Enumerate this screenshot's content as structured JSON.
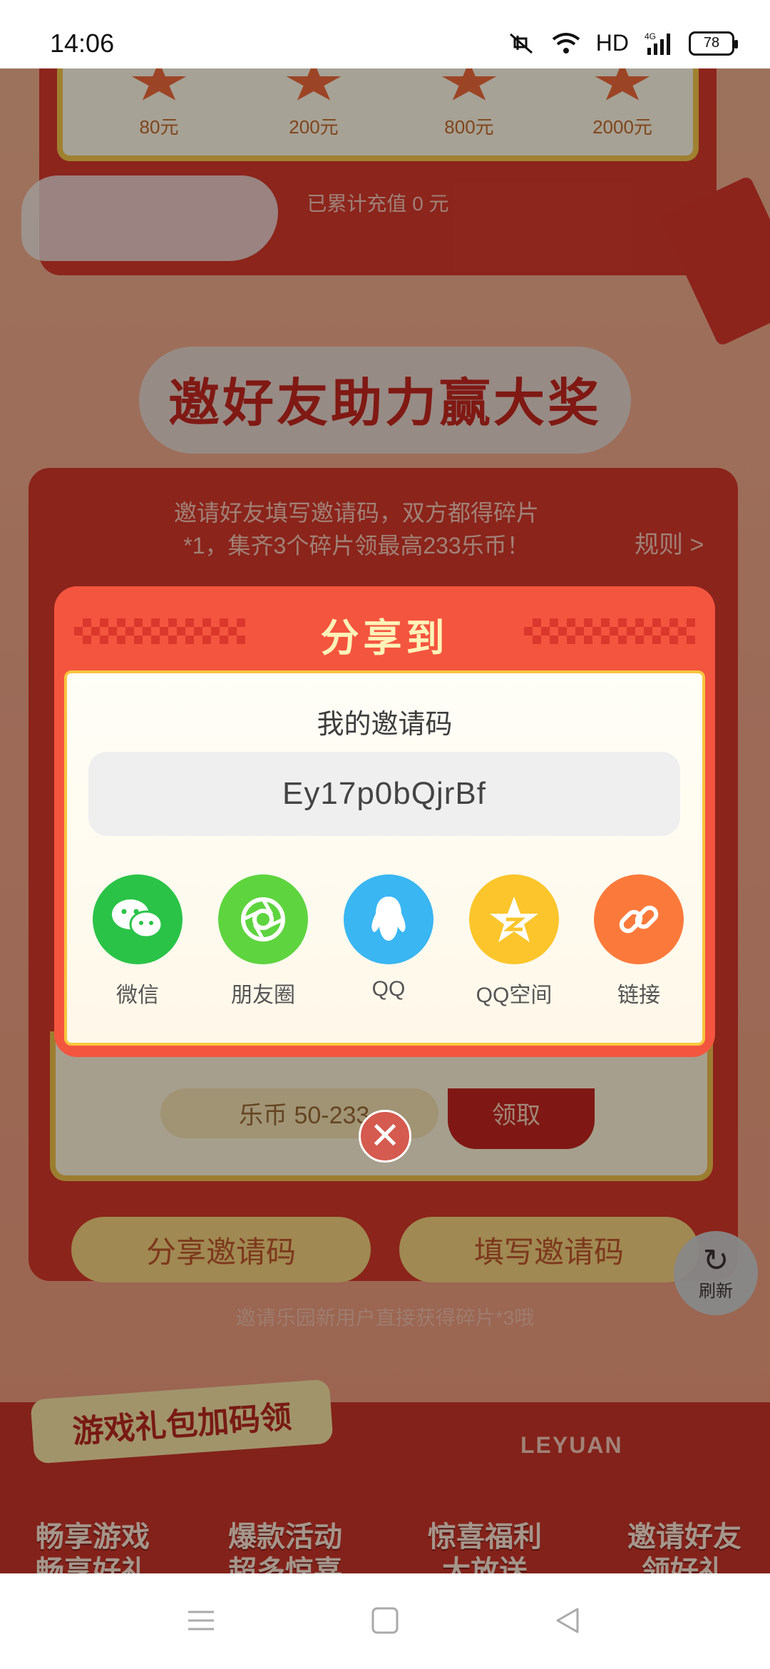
{
  "status_bar": {
    "time": "14:06",
    "network_label": "HD",
    "signal_label": "4G",
    "battery": "78"
  },
  "recharge": {
    "tiers": [
      "80元",
      "200元",
      "800元",
      "2000元"
    ],
    "total_text": "已累计充值 0 元"
  },
  "invite_section": {
    "title": "邀好友助力赢大奖",
    "hint_line1": "邀请好友填写邀请码，双方都得碎片",
    "hint_line2": "*1，集齐3个碎片领最高233乐币！",
    "rules_label": "规则 >",
    "coin_label": "乐币 50-233",
    "claim_label": "领取",
    "share_code_button": "分享邀请码",
    "fill_code_button": "填写邀请码",
    "note": "邀请乐园新用户直接获得碎片*3哦"
  },
  "refresh_button": "刷新",
  "gift_section": {
    "tag": "游戏礼包加码领",
    "brand": "LEYUAN",
    "features": [
      {
        "line1": "畅享游戏",
        "line2": "畅享好礼"
      },
      {
        "line1": "爆款活动",
        "line2": "超多惊喜"
      },
      {
        "line1": "惊喜福利",
        "line2": "大放送"
      },
      {
        "line1": "邀请好友",
        "line2": "领好礼"
      }
    ]
  },
  "share_dialog": {
    "title": "分享到",
    "code_label": "我的邀请码",
    "code_value": "Ey17p0bQjrBf",
    "targets": [
      {
        "label": "微信",
        "icon": "wechat-icon",
        "color": "#2ac348"
      },
      {
        "label": "朋友圈",
        "icon": "moments-icon",
        "color": "#5ed43f"
      },
      {
        "label": "QQ",
        "icon": "qq-icon",
        "color": "#3ab6f2"
      },
      {
        "label": "QQ空间",
        "icon": "qzone-icon",
        "color": "#fbc52b"
      },
      {
        "label": "链接",
        "icon": "link-icon",
        "color": "#fb7a3b"
      }
    ],
    "close_label": "✕"
  }
}
